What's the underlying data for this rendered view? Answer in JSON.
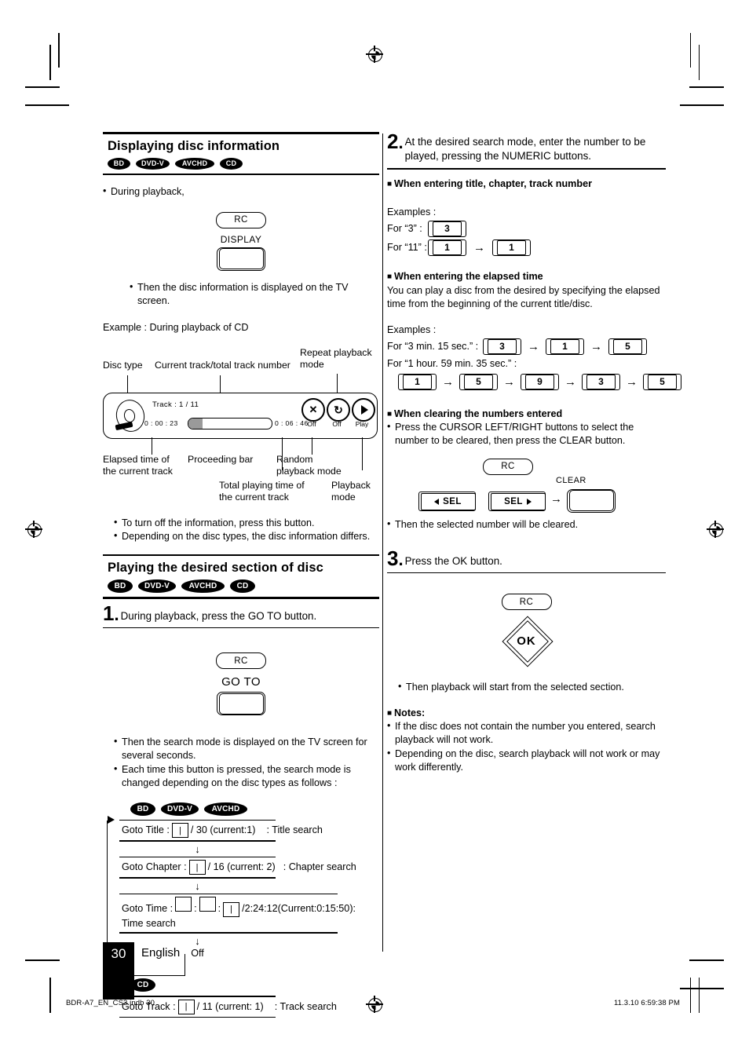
{
  "page": {
    "number": "30",
    "language": "English",
    "footer_left": "BDR-A7_EN_CS3.indb   30",
    "footer_right": "11.3.10   6:59:38 PM"
  },
  "disc_badges": {
    "bd": "BD",
    "dvd": "DVD-V",
    "avchd": "AVCHD",
    "cd": "CD"
  },
  "left": {
    "section1_title": "Displaying disc information",
    "during_playback": "During playback,",
    "rc_label": "RC",
    "display_label": "DISPLAY",
    "note_display": "Then the disc information is displayed on the TV screen.",
    "example_label": "Example : During playback of CD",
    "callouts": {
      "disc_type": "Disc type",
      "current_track": "Current track/total track number",
      "repeat_mode": "Repeat playback\nmode",
      "elapsed": "Elapsed time of\nthe current track",
      "proceeding": "Proceeding bar",
      "total_time": "Total playing time of\nthe current track",
      "random": "Random\nplayback mode",
      "playback_mode": "Playback\nmode"
    },
    "panel": {
      "track": "Track : 1 / 11",
      "elapsed_time": "0 : 00 : 23",
      "total_time": "0 : 06 : 46",
      "random_state": "Off",
      "repeat_state": "Off",
      "play_state": "Play"
    },
    "bullets_after": [
      "To turn off the information, press this button.",
      "Depending on the disc types, the disc information differs."
    ],
    "section2_title": "Playing the desired section of disc",
    "step1_num": "1",
    "step1_text": "During playback, press the GO TO button.",
    "goto_label": "GO TO",
    "bullets_goto": [
      "Then the search mode is displayed on the TV screen for several seconds.",
      "Each time this button is pressed, the search mode is changed depending on the disc types as follows :"
    ],
    "flow": {
      "title_row_label": "Goto Title :",
      "title_row_tail": "/ 30 (current:1)",
      "title_row_desc": ": Title search",
      "chapter_row_label": "Goto Chapter :",
      "chapter_row_tail": "/ 16 (current: 2)",
      "chapter_row_desc": ": Chapter search",
      "time_row_label": "Goto Time :",
      "time_row_tail": "/2:24:12(Current:0:15:50):",
      "time_row_desc": "Time search",
      "off": "Off",
      "track_row_label": "Goto Track :",
      "track_row_tail": "/ 11 (current: 1)",
      "track_row_desc": ": Track search",
      "down_arrow": "↓",
      "colon": ":"
    }
  },
  "right": {
    "step2_num": "2",
    "step2_text": "At the desired search mode, enter the number to be played, pressing the NUMERIC buttons.",
    "head_title_chapter": "When entering title, chapter, track number",
    "examples_label": "Examples :",
    "ex_for3": "For “3” :",
    "ex_for11": "For “11” :",
    "keys_3": [
      "3"
    ],
    "keys_11": [
      "1",
      "1"
    ],
    "head_elapsed": "When entering the elapsed time",
    "elapsed_desc": "You can play a disc from the desired by specifying the elapsed time from the beginning of the current title/disc.",
    "ex_3min": "For “3 min. 15 sec.” :",
    "keys_3min": [
      "3",
      "1",
      "5"
    ],
    "ex_1hour": "For “1 hour. 59 min. 35 sec.” :",
    "keys_1hour": [
      "1",
      "5",
      "9",
      "3",
      "5"
    ],
    "head_clearing": "When clearing the numbers entered",
    "clearing_bullet": "Press the CURSOR LEFT/RIGHT buttons to select the number to be cleared, then press the CLEAR button.",
    "rc_label": "RC",
    "sel_left": "SEL",
    "sel_right": "SEL",
    "clear_label": "CLEAR",
    "cleared_note": "Then the selected number will be cleared.",
    "step3_num": "3",
    "step3_text": "Press the OK button.",
    "ok_label": "OK",
    "ok_note": "Then playback will start from the selected section.",
    "notes_head": "Notes:",
    "notes": [
      "If the disc does not contain the number you entered, search playback will not work.",
      "Depending on the disc, search playback will not work or may work differently."
    ],
    "arrow": "→"
  }
}
